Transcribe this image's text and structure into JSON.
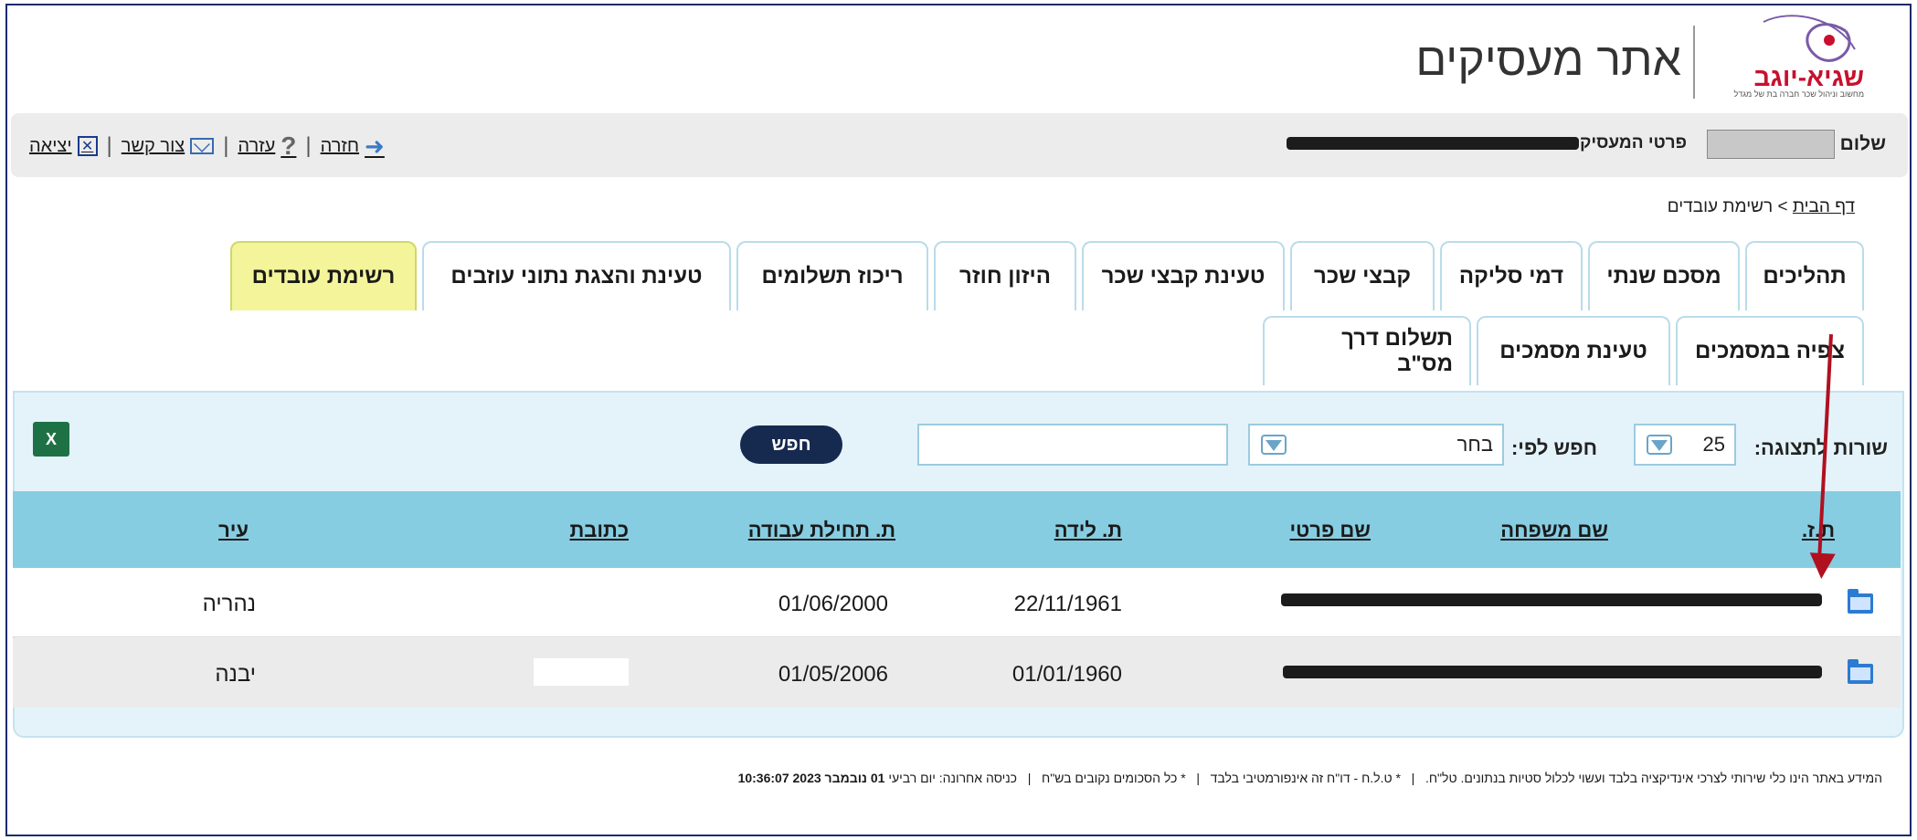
{
  "header": {
    "site_title": "אתר מעסיקים",
    "logo_name": "שגיא-יוגב",
    "logo_sub": "מחשוב וניהול שכר חברה בת של מגדל"
  },
  "topbar": {
    "greeting": "שלום",
    "employer_label": "פרטי המעסיק",
    "links": {
      "exit": "יציאה",
      "contact": "צור קשר",
      "help": "עזרה",
      "back": "חזרה"
    }
  },
  "breadcrumb": {
    "home": "דף הבית",
    "separator": ">",
    "current": "רשימת עובדים"
  },
  "tabs_row1": [
    "רשימת עובדים",
    "טעינת והצגת נתוני עוזבים",
    "ריכוז תשלומים",
    "היזון חוזר",
    "טעינת קבצי שכר",
    "קבצי שכר",
    "דמי סליקה",
    "מסכם שנתי",
    "תהליכים"
  ],
  "tabs_row2": [
    "תשלום דרך מס\"ב",
    "טעינת מסמכים",
    "צפיה במסמכים"
  ],
  "search": {
    "rows_label": "שורות לתצוגה:",
    "rows_value": "25",
    "search_by_label": "חפש לפי:",
    "search_by_value": "בחר",
    "search_text": "",
    "search_button": "חפש"
  },
  "table": {
    "columns": [
      "ת.ז.",
      "שם משפחה",
      "שם פרטי",
      "ת. לידה",
      "ת. תחילת עבודה",
      "כתובת",
      "עיר"
    ],
    "rows": [
      {
        "birth_date": "22/11/1961",
        "start_date": "01/06/2000",
        "city": "נהריה"
      },
      {
        "birth_date": "01/01/1960",
        "start_date": "01/05/2006",
        "city": "יבנה"
      }
    ]
  },
  "footer": {
    "note1": "המידע באתר הינו כלי שירותי לצרכי אינדיקציה בלבד ועשוי לכלול סטיות בנתונים. טל\"ח.",
    "note2": "* ט.ל.ח - דו\"ח זה אינפורמטיבי בלבד",
    "note3": "* כל הסכומים נקובים בש\"ח",
    "last_login_label": "כניסה אחרונה: יום רביעי",
    "last_login_value": "01 נובמבר 2023 10:36:07"
  },
  "colors": {
    "active_tab": "#f4f59a",
    "table_header": "#86cde2",
    "panel_bg": "#e4f3fa",
    "search_button": "#16294f",
    "annotation_arrow": "#b01020"
  }
}
